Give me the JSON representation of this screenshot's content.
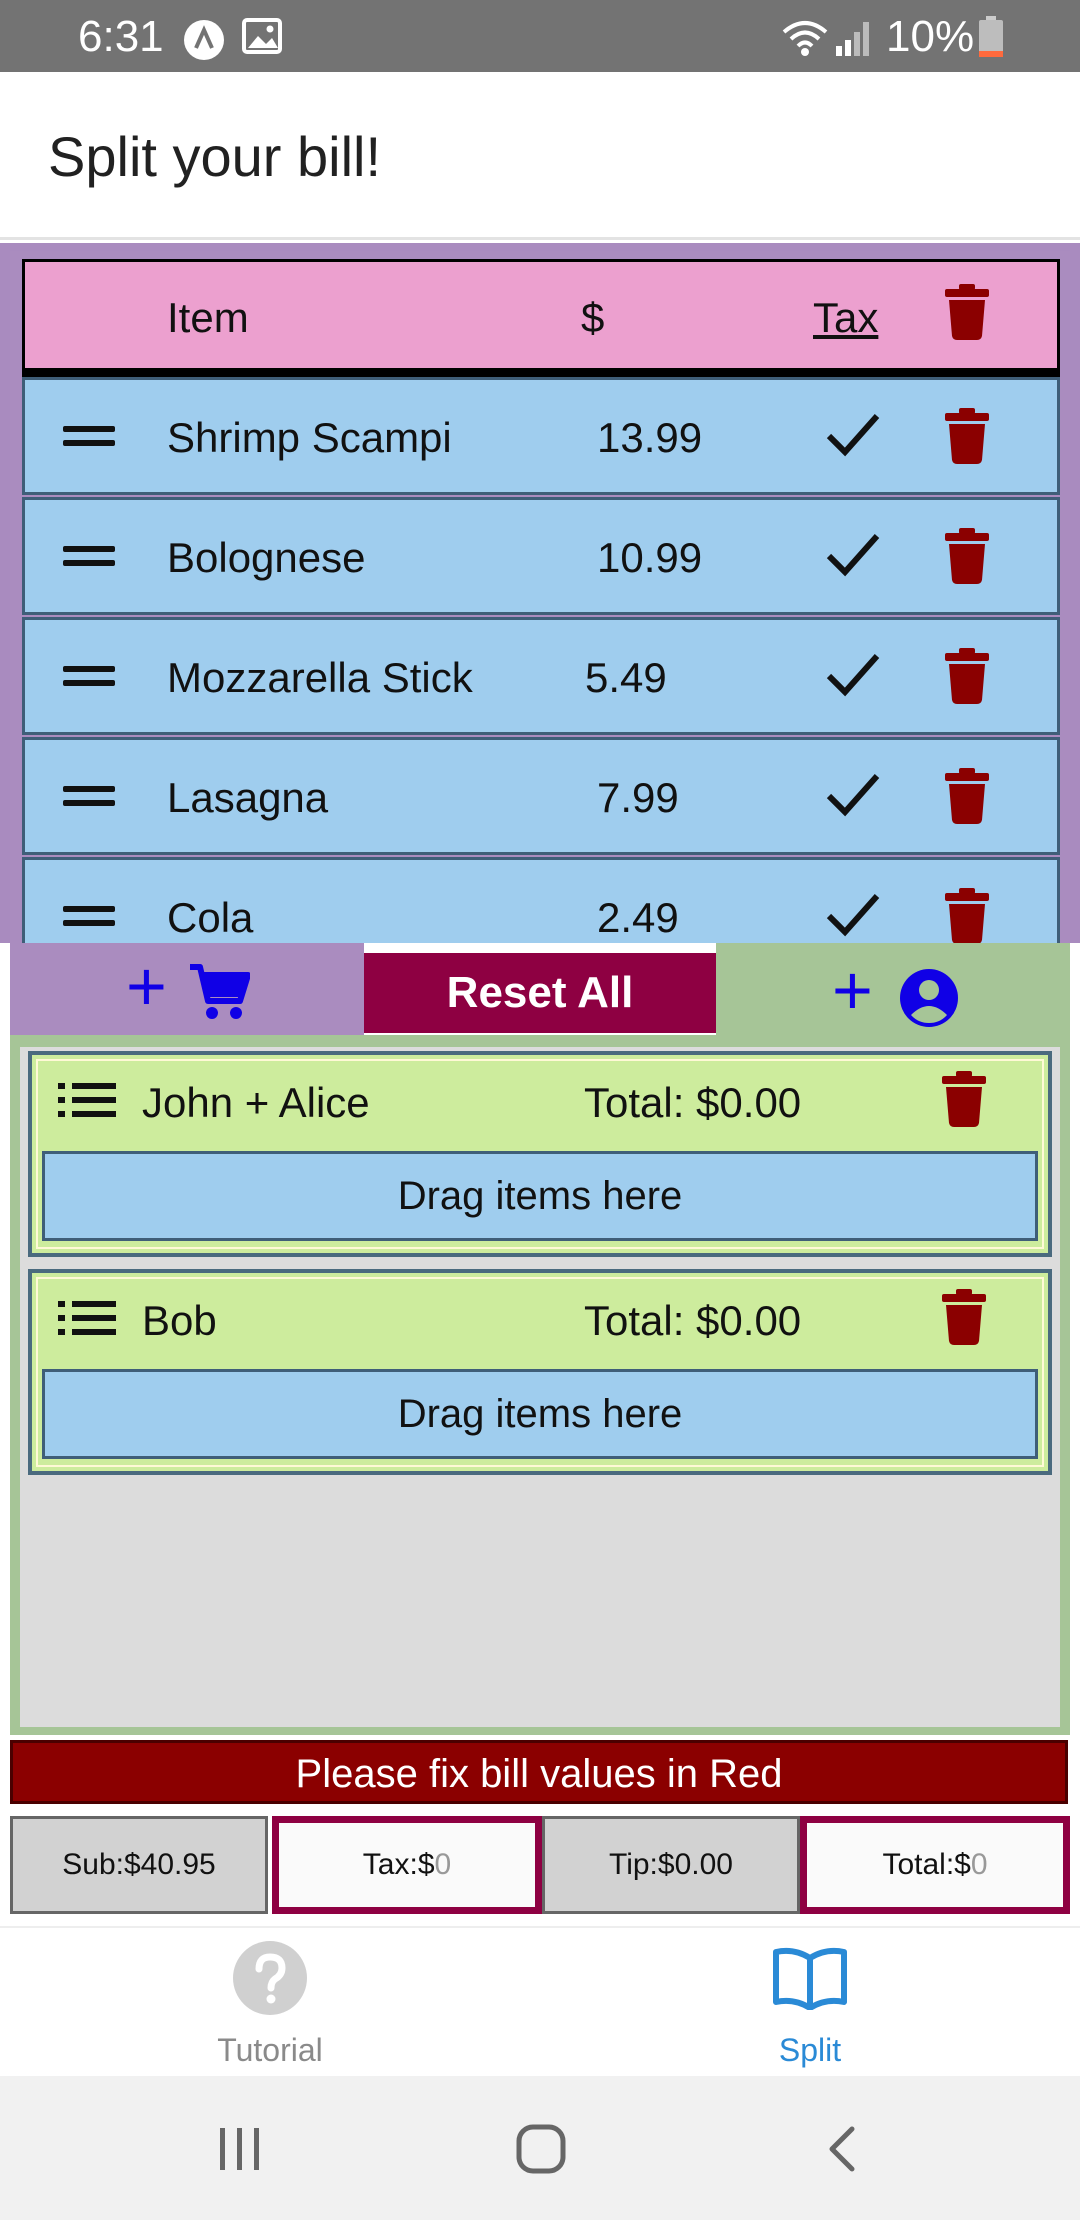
{
  "status_bar": {
    "time": "6:31",
    "battery": "10%"
  },
  "header": {
    "title": "Split your bill!"
  },
  "items_table": {
    "headers": {
      "item": "Item",
      "price": "$",
      "tax": "Tax"
    },
    "rows": [
      {
        "name": "Shrimp Scampi",
        "price": "13.99",
        "taxed": true
      },
      {
        "name": "Bolognese",
        "price": "10.99",
        "taxed": true
      },
      {
        "name": "Mozzarella Stick",
        "price": "5.49",
        "taxed": true
      },
      {
        "name": "Lasagna",
        "price": "7.99",
        "taxed": true
      },
      {
        "name": "Cola",
        "price": "2.49",
        "taxed": true
      }
    ]
  },
  "controls": {
    "add_item_plus": "+",
    "reset_label": "Reset All",
    "add_person_plus": "+"
  },
  "groups": [
    {
      "name": "John + Alice",
      "total": "Total: $0.00",
      "dropzone": "Drag items here"
    },
    {
      "name": "Bob",
      "total": "Total: $0.00",
      "dropzone": "Drag items here"
    }
  ],
  "error_banner": "Please fix bill values in Red",
  "totals": {
    "sub": "Sub:$40.95",
    "tax_label": "Tax:$",
    "tax_placeholder": "0",
    "tip": "Tip:$0.00",
    "total_label": "Total:$",
    "total_placeholder": "0"
  },
  "bottom_nav": {
    "tabs": [
      {
        "label": "Tutorial",
        "icon": "question-icon",
        "active": false
      },
      {
        "label": "Split",
        "icon": "book-icon",
        "active": true
      }
    ]
  },
  "colors": {
    "accent": "#2a8ad6",
    "trash": "#8b0000",
    "reset": "#8e0042",
    "add_blue": "#1000e6"
  }
}
